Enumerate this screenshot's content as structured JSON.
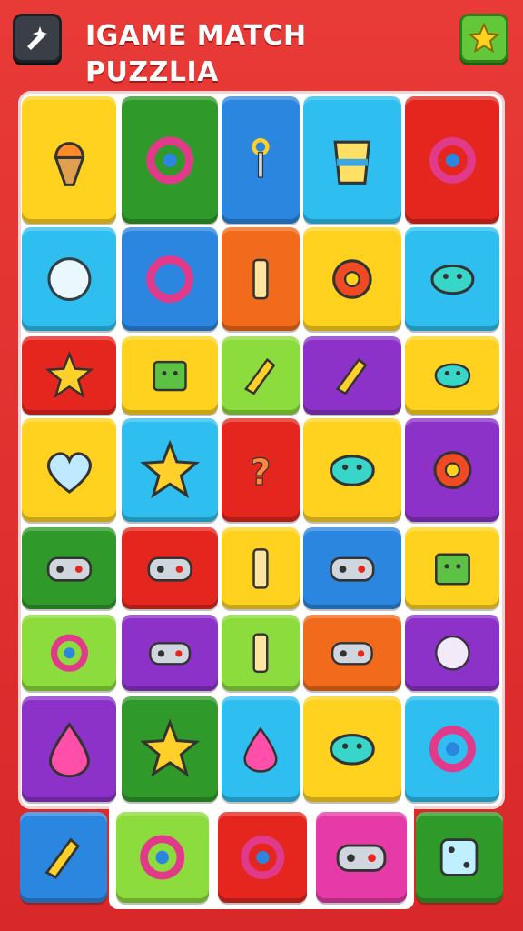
{
  "header": {
    "title": "IGAME MATCH PUZZLIA",
    "tool_button_icon": "sparkle-cross-icon",
    "star_button_icon": "star-icon"
  },
  "colors": {
    "yellow": "#ffd21f",
    "green": "#2f9a2a",
    "blue": "#2b86e0",
    "cyan": "#2ebff0",
    "red": "#e4261f",
    "orange": "#f26a1c",
    "purple": "#8c32c8",
    "lime": "#8bdc3c",
    "pink": "#e63aa8"
  },
  "board": {
    "rows": [
      [
        {
          "color": "yellow",
          "icon": "ice-cream-icon"
        },
        {
          "color": "green",
          "icon": "lollipop-ring-icon"
        },
        {
          "color": "blue",
          "icon": "key-icon"
        },
        {
          "color": "cyan",
          "icon": "cup-icon"
        },
        {
          "color": "red",
          "icon": "heart-badge-icon"
        }
      ],
      [
        {
          "color": "cyan",
          "icon": "orb-arrow-icon"
        },
        {
          "color": "blue",
          "icon": "donut-icon"
        },
        {
          "color": "orange",
          "icon": "battery-icon"
        },
        {
          "color": "yellow",
          "icon": "gear-icon"
        },
        {
          "color": "cyan",
          "icon": "splat-arrow-icon"
        }
      ],
      [
        {
          "color": "red",
          "icon": "star-pin-icon"
        },
        {
          "color": "yellow",
          "icon": "cube-face-icon"
        },
        {
          "color": "lime",
          "icon": "crossed-tools-icon"
        },
        {
          "color": "purple",
          "icon": "pen-icon"
        },
        {
          "color": "yellow",
          "icon": "leaf-brush-icon"
        }
      ],
      [
        {
          "color": "yellow",
          "icon": "heart-icon"
        },
        {
          "color": "cyan",
          "icon": "sun-splat-icon"
        },
        {
          "color": "red",
          "icon": "question-icon"
        },
        {
          "color": "yellow",
          "icon": "smiley-blob-icon"
        },
        {
          "color": "purple",
          "icon": "cog-arrow-icon"
        }
      ],
      [
        {
          "color": "green",
          "icon": "controller-stick-icon"
        },
        {
          "color": "red",
          "icon": "gamepad-icon"
        },
        {
          "color": "yellow",
          "icon": "phone-icon"
        },
        {
          "color": "blue",
          "icon": "camera-icon"
        },
        {
          "color": "yellow",
          "icon": "handheld-console-icon"
        }
      ],
      [
        {
          "color": "lime",
          "icon": "target-ring-icon"
        },
        {
          "color": "purple",
          "icon": "gamepad-icon"
        },
        {
          "color": "lime",
          "icon": "capsule-icon"
        },
        {
          "color": "orange",
          "icon": "photo-camera-icon"
        },
        {
          "color": "purple",
          "icon": "wrapped-candy-icon"
        }
      ],
      [
        {
          "color": "purple",
          "icon": "jelly-icon"
        },
        {
          "color": "green",
          "icon": "spiky-ball-icon"
        },
        {
          "color": "cyan",
          "icon": "cherry-blob-icon"
        },
        {
          "color": "yellow",
          "icon": "smiley-monster-icon"
        },
        {
          "color": "cyan",
          "icon": "ring-brush-icon"
        }
      ]
    ],
    "bottom_row": [
      {
        "color": "blue",
        "icon": "brush-icon"
      },
      {
        "color": "lime",
        "icon": "speaker-icon"
      },
      {
        "color": "red",
        "icon": "dial-icon"
      },
      {
        "color": "pink",
        "icon": "gamepad-icon"
      },
      {
        "color": "green",
        "icon": "dice-icon"
      }
    ]
  }
}
